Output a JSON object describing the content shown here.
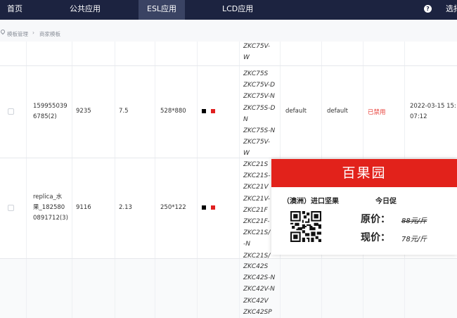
{
  "nav": {
    "items": [
      "首页",
      "公共应用",
      "ESL应用",
      "LCD应用"
    ],
    "active": "ESL应用",
    "help_icon": "question-icon",
    "user_partial": "选择"
  },
  "breadcrumb": {
    "icon": "location-pin-icon",
    "items": [
      "模板管理",
      "商家模板"
    ]
  },
  "rows": [
    {
      "models": [
        "ZKC75V-",
        "W"
      ]
    },
    {
      "id": "1599550396785(2)",
      "id_lines": [
        "159955039",
        "6785(2)"
      ],
      "num": "9235",
      "size": "7.5",
      "resolution": "528*880",
      "colors": [
        "#000000",
        "#e02020"
      ],
      "models": [
        "ZKC75S",
        "ZKC75V-D",
        "ZKC75V-N",
        "ZKC75S-D",
        "N",
        "ZKC75S-N",
        "ZKC75V-",
        "W"
      ],
      "col_default1": "default",
      "col_default2": "default",
      "status": "已禁用",
      "date_lines": [
        "2022-03-15 15:",
        "07:12"
      ]
    },
    {
      "name_lines": [
        "replica_水",
        "果_182580",
        "0891712(3)"
      ],
      "num": "9116",
      "size": "2.13",
      "resolution": "250*122",
      "colors": [
        "#000000",
        "#e02020"
      ],
      "models": [
        "ZKC21S",
        "ZKC21S-",
        "ZKC21V",
        "ZKC21V-",
        "ZKC21F",
        "ZKC21F-",
        "ZKC21S/",
        "-N",
        "ZKC21S/"
      ]
    },
    {
      "models": [
        "ZKC42S",
        "ZKC42S-N",
        "ZKC42V-N",
        "ZKC42V",
        "ZKC42SP"
      ]
    }
  ],
  "esl_preview": {
    "store": "百果园",
    "origin": "（澳洲）进口坚果",
    "promo": "今日促",
    "original_label": "原价：",
    "original_value": "88元/斤",
    "current_label": "现价：",
    "current_value": "78元/斤",
    "header_color": "#e2221b"
  }
}
